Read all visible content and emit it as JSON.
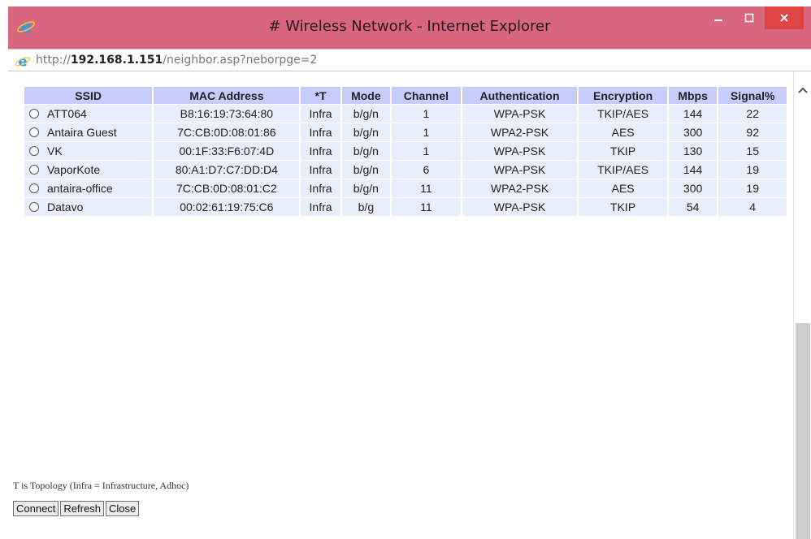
{
  "window": {
    "title": "# Wireless Network - Internet Explorer",
    "url_prefix": "http://",
    "url_host": "192.168.1.151",
    "url_path": "/neighbor.asp?neborpge=2",
    "title_bar_color": "#d9667f",
    "close_button_color": "#e04343"
  },
  "table": {
    "headers": [
      "SSID",
      "MAC Address",
      "*T",
      "Mode",
      "Channel",
      "Authentication",
      "Encryption",
      "Mbps",
      "Signal%"
    ],
    "rows": [
      {
        "ssid": "ATT064",
        "mac": "B8:16:19:73:64:80",
        "t": "Infra",
        "mode": "b/g/n",
        "channel": "1",
        "auth": "WPA-PSK",
        "enc": "TKIP/AES",
        "mbps": "144",
        "signal": "22"
      },
      {
        "ssid": "Antaira Guest",
        "mac": "7C:CB:0D:08:01:86",
        "t": "Infra",
        "mode": "b/g/n",
        "channel": "1",
        "auth": "WPA2-PSK",
        "enc": "AES",
        "mbps": "300",
        "signal": "92"
      },
      {
        "ssid": "VK",
        "mac": "00:1F:33:F6:07:4D",
        "t": "Infra",
        "mode": "b/g/n",
        "channel": "1",
        "auth": "WPA-PSK",
        "enc": "TKIP",
        "mbps": "130",
        "signal": "15"
      },
      {
        "ssid": "VaporKote",
        "mac": "80:A1:D7:C7:DD:D4",
        "t": "Infra",
        "mode": "b/g/n",
        "channel": "6",
        "auth": "WPA-PSK",
        "enc": "TKIP/AES",
        "mbps": "144",
        "signal": "19"
      },
      {
        "ssid": "antaira-office",
        "mac": "7C:CB:0D:08:01:C2",
        "t": "Infra",
        "mode": "b/g/n",
        "channel": "11",
        "auth": "WPA2-PSK",
        "enc": "AES",
        "mbps": "300",
        "signal": "19"
      },
      {
        "ssid": "Datavo",
        "mac": "00:02:61:19:75:C6",
        "t": "Infra",
        "mode": "b/g",
        "channel": "11",
        "auth": "WPA-PSK",
        "enc": "TKIP",
        "mbps": "54",
        "signal": "4"
      }
    ]
  },
  "legend": "T is Topology (Infra = Infrastructure, Adhoc)",
  "buttons": {
    "connect": "Connect",
    "refresh": "Refresh",
    "close": "Close"
  }
}
